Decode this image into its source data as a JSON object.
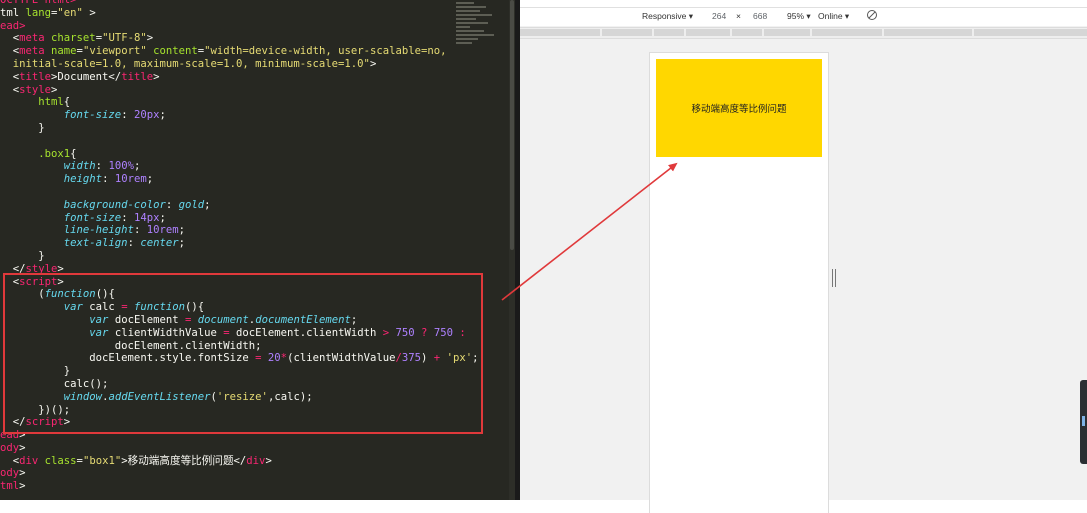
{
  "editor": {
    "lines": [
      [
        [
          "tag",
          "OCTYPE html>"
        ]
      ],
      [
        [
          "txt",
          "tml "
        ],
        [
          "attr",
          "lang"
        ],
        [
          "txt",
          "="
        ],
        [
          "str",
          "\"en\""
        ],
        [
          "txt",
          " >"
        ]
      ],
      [
        [
          "tag",
          "ead>"
        ]
      ],
      [
        [
          "txt",
          "  <"
        ],
        [
          "tag",
          "meta "
        ],
        [
          "attr",
          "charset"
        ],
        [
          "txt",
          "="
        ],
        [
          "str",
          "\"UTF-8\""
        ],
        [
          "txt",
          ">"
        ]
      ],
      [
        [
          "txt",
          "  <"
        ],
        [
          "tag",
          "meta "
        ],
        [
          "attr",
          "name"
        ],
        [
          "txt",
          "="
        ],
        [
          "str",
          "\"viewport\""
        ],
        [
          "txt",
          " "
        ],
        [
          "attr",
          "content"
        ],
        [
          "txt",
          "="
        ],
        [
          "str",
          "\"width=device-width, user-scalable=no,"
        ]
      ],
      [
        [
          "str",
          "  initial-scale=1.0, maximum-scale=1.0, minimum-scale=1.0\""
        ],
        [
          "txt",
          ">"
        ]
      ],
      [
        [
          "txt",
          "  <"
        ],
        [
          "tag",
          "title"
        ],
        [
          "txt",
          ">Document</"
        ],
        [
          "tag",
          "title"
        ],
        [
          "txt",
          ">"
        ]
      ],
      [
        [
          "txt",
          "  <"
        ],
        [
          "tag",
          "style"
        ],
        [
          "txt",
          ">"
        ]
      ],
      [
        [
          "sel",
          "      html"
        ],
        [
          "txt",
          "{"
        ]
      ],
      [
        [
          "prop",
          "          font-size"
        ],
        [
          "txt",
          ": "
        ],
        [
          "num",
          "20px"
        ],
        [
          "txt",
          ";"
        ]
      ],
      [
        [
          "txt",
          "      }"
        ]
      ],
      [
        [
          "txt",
          ""
        ]
      ],
      [
        [
          "sel",
          "      .box1"
        ],
        [
          "txt",
          "{"
        ]
      ],
      [
        [
          "prop",
          "          width"
        ],
        [
          "txt",
          ": "
        ],
        [
          "num",
          "100%"
        ],
        [
          "txt",
          ";"
        ]
      ],
      [
        [
          "prop",
          "          height"
        ],
        [
          "txt",
          ": "
        ],
        [
          "num",
          "10rem"
        ],
        [
          "txt",
          ";"
        ]
      ],
      [
        [
          "txt",
          ""
        ]
      ],
      [
        [
          "prop",
          "          background-color"
        ],
        [
          "txt",
          ": "
        ],
        [
          "kw",
          "gold"
        ],
        [
          "txt",
          ";"
        ]
      ],
      [
        [
          "prop",
          "          font-size"
        ],
        [
          "txt",
          ": "
        ],
        [
          "num",
          "14px"
        ],
        [
          "txt",
          ";"
        ]
      ],
      [
        [
          "prop",
          "          line-height"
        ],
        [
          "txt",
          ": "
        ],
        [
          "num",
          "10rem"
        ],
        [
          "txt",
          ";"
        ]
      ],
      [
        [
          "prop",
          "          text-align"
        ],
        [
          "txt",
          ": "
        ],
        [
          "kw",
          "center"
        ],
        [
          "txt",
          ";"
        ]
      ],
      [
        [
          "txt",
          "      }"
        ]
      ],
      [
        [
          "txt",
          "  </"
        ],
        [
          "tag",
          "style"
        ],
        [
          "txt",
          ">"
        ]
      ],
      [
        [
          "txt",
          "  <"
        ],
        [
          "tag",
          "script"
        ],
        [
          "txt",
          ">"
        ]
      ],
      [
        [
          "txt",
          "      ("
        ],
        [
          "kw",
          "function"
        ],
        [
          "txt",
          "(){"
        ]
      ],
      [
        [
          "kw",
          "          var "
        ],
        [
          "txt",
          "calc "
        ],
        [
          "op",
          "="
        ],
        [
          "txt",
          " "
        ],
        [
          "kw",
          "function"
        ],
        [
          "txt",
          "(){"
        ]
      ],
      [
        [
          "kw",
          "              var "
        ],
        [
          "txt",
          "docElement "
        ],
        [
          "op",
          "="
        ],
        [
          "txt",
          " "
        ],
        [
          "kw",
          "document"
        ],
        [
          "txt",
          "."
        ],
        [
          "kw",
          "documentElement"
        ],
        [
          "txt",
          ";"
        ]
      ],
      [
        [
          "kw",
          "              var "
        ],
        [
          "txt",
          "clientWidthValue "
        ],
        [
          "op",
          "="
        ],
        [
          "txt",
          " docElement.clientWidth "
        ],
        [
          "op",
          ">"
        ],
        [
          "txt",
          " "
        ],
        [
          "num",
          "750"
        ],
        [
          "txt",
          " "
        ],
        [
          "op",
          "?"
        ],
        [
          "txt",
          " "
        ],
        [
          "num",
          "750"
        ],
        [
          "txt",
          " "
        ],
        [
          "op",
          ":"
        ]
      ],
      [
        [
          "txt",
          "                  docElement.clientWidth;"
        ]
      ],
      [
        [
          "txt",
          "              docElement.style.fontSize "
        ],
        [
          "op",
          "="
        ],
        [
          "txt",
          " "
        ],
        [
          "num",
          "20"
        ],
        [
          "op",
          "*"
        ],
        [
          "txt",
          "(clientWidthValue"
        ],
        [
          "op",
          "/"
        ],
        [
          "num",
          "375"
        ],
        [
          "txt",
          ") "
        ],
        [
          "op",
          "+"
        ],
        [
          "txt",
          " "
        ],
        [
          "str",
          "'px'"
        ],
        [
          "txt",
          ";"
        ]
      ],
      [
        [
          "txt",
          "          }"
        ]
      ],
      [
        [
          "txt",
          "          calc();"
        ]
      ],
      [
        [
          "kw",
          "          window"
        ],
        [
          "txt",
          "."
        ],
        [
          "kw",
          "addEventListener"
        ],
        [
          "txt",
          "("
        ],
        [
          "str",
          "'resize'"
        ],
        [
          "txt",
          ",calc);"
        ]
      ],
      [
        [
          "txt",
          "      })();"
        ]
      ],
      [
        [
          "txt",
          "  </"
        ],
        [
          "tag",
          "script"
        ],
        [
          "txt",
          ">"
        ]
      ],
      [
        [
          "tag",
          "ead"
        ],
        [
          "txt",
          ">"
        ]
      ],
      [
        [
          "tag",
          "ody"
        ],
        [
          "txt",
          ">"
        ]
      ],
      [
        [
          "txt",
          "  <"
        ],
        [
          "tag",
          "div "
        ],
        [
          "attr",
          "class"
        ],
        [
          "txt",
          "="
        ],
        [
          "str",
          "\"box1\""
        ],
        [
          "txt",
          ">移动端高度等比例问题</"
        ],
        [
          "tag",
          "div"
        ],
        [
          "txt",
          ">"
        ]
      ],
      [
        [
          "tag",
          "ody"
        ],
        [
          "txt",
          ">"
        ]
      ],
      [
        [
          "tag",
          "tml"
        ],
        [
          "txt",
          ">"
        ]
      ]
    ]
  },
  "devtools": {
    "device_mode": "Responsive ▾",
    "width": "264",
    "times": "×",
    "height": "668",
    "zoom": "95% ▾",
    "network": "Online ▾",
    "rotate_icon": "⃠"
  },
  "preview": {
    "box_text": "移动端高度等比例问题"
  },
  "colors": {
    "editor_bg": "#272822",
    "box_bg": "#ffd700",
    "annotation": "#e0393b"
  }
}
